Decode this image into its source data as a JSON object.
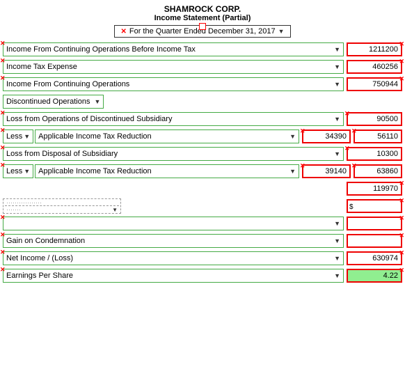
{
  "header": {
    "company": "SHAMROCK CORP.",
    "statement": "Income Statement (Partial)",
    "period_label": "For the Quarter Ended December 31, 2017",
    "period_arrow": "▼"
  },
  "rows": {
    "income_before_tax_label": "Income From Continuing Operations Before Income Tax",
    "income_before_tax_value": "1211200",
    "income_tax_label": "Income Tax Expense",
    "income_tax_value": "460256",
    "income_from_ops_label": "Income From Continuing Operations",
    "income_from_ops_value": "750944",
    "discontinued_label": "Discontinued Operations",
    "loss_ops_label": "Loss from Operations of Discontinued Subsidiary",
    "loss_ops_value": "90500",
    "less1_label": "Less",
    "applicable1_label": "Applicable Income Tax Reduction",
    "applicable1_value1": "34390",
    "applicable1_value2": "56110",
    "loss_disposal_label": "Loss from Disposal of Subsidiary",
    "loss_disposal_value": "10300",
    "less2_label": "Less",
    "applicable2_label": "Applicable Income Tax Reduction",
    "applicable2_value1": "39140",
    "applicable2_value2": "63860",
    "subtotal_value": "119970",
    "gain_label": "Gain on Condemnation",
    "net_income_label": "Net Income / (Loss)",
    "net_income_value": "630974",
    "eps_label": "Earnings Per Share",
    "eps_value": "4.22"
  }
}
